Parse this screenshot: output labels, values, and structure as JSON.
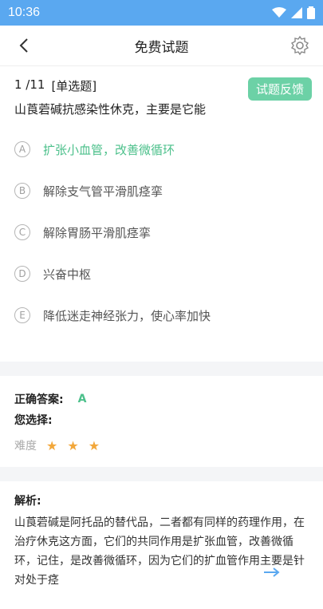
{
  "status_bar": {
    "time": "10:36"
  },
  "header": {
    "title": "免费试题"
  },
  "question": {
    "index": "1 /11",
    "type": "[单选题]",
    "feedback_label": "试题反馈",
    "text": "山莨菪碱抗感染性休克，主要是它能",
    "options": [
      {
        "letter": "A",
        "text": "扩张小血管，改善微循环"
      },
      {
        "letter": "B",
        "text": "解除支气管平滑肌痉挛"
      },
      {
        "letter": "C",
        "text": "解除胃肠平滑肌痉挛"
      },
      {
        "letter": "D",
        "text": "兴奋中枢"
      },
      {
        "letter": "E",
        "text": "降低迷走神经张力，使心率加快"
      }
    ],
    "correct_option": "A"
  },
  "answer": {
    "correct_label": "正确答案:",
    "correct_value": "A",
    "your_choice_label": "您选择:",
    "difficulty_label": "难度",
    "difficulty_stars": 3
  },
  "analysis": {
    "title": "解析:",
    "text": "山莨菪碱是阿托品的替代品，二者都有同样的药理作用，在治疗休克这方面，它们的共同作用是扩张血管，改善微循环，记住，是改善微循环，因为它们的扩血管作用主要是针对处于痉"
  },
  "colors": {
    "accent_green": "#4cc08b",
    "status_bar": "#5aa8f0",
    "star": "#f2a73a"
  }
}
